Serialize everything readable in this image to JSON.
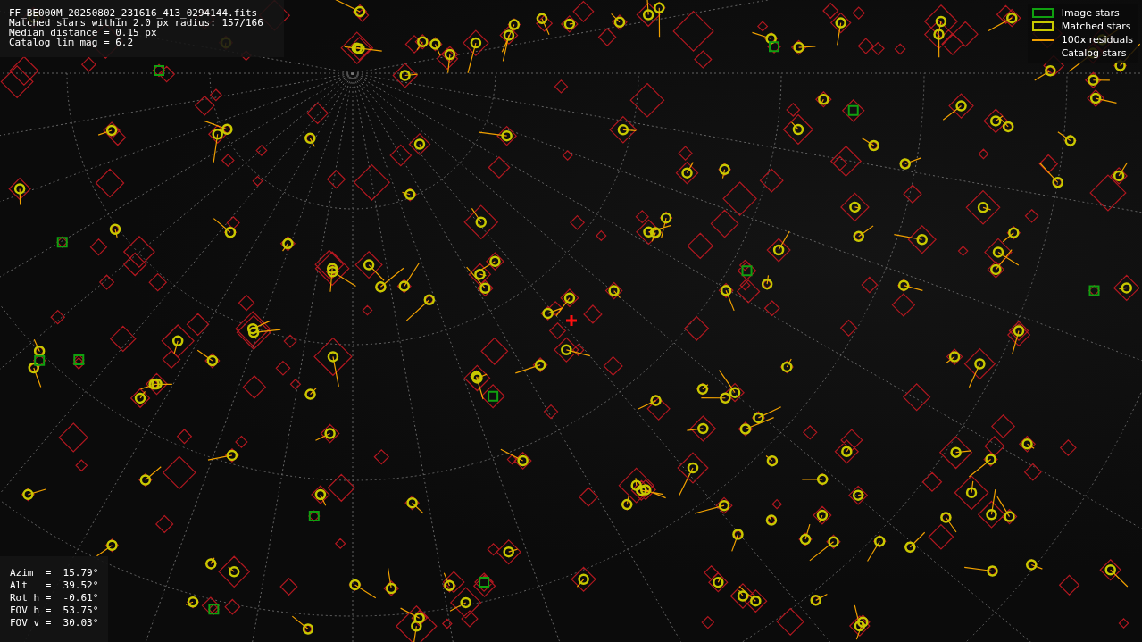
{
  "file_info": [
    "FF_BE000M_20250802_231616_413_0294144.fits",
    "Matched stars within 2.0 px radius: 157/166",
    "Median distance = 0.15 px",
    "Catalog lim mag = 6.2"
  ],
  "legend": [
    {
      "label": "Image stars",
      "kind": "box",
      "color": "#10a010"
    },
    {
      "label": "Matched stars",
      "kind": "box",
      "color": "#c8c800"
    },
    {
      "label": "100x residuals",
      "kind": "line",
      "color": "#f0a000"
    },
    {
      "label": "Catalog stars",
      "kind": "none"
    }
  ],
  "pointing": [
    "Azim  =  15.79°",
    "Alt   =  39.52°",
    "Rot h =  -0.61°",
    "FOV h =  53.75°",
    "FOV v =  30.03°"
  ]
}
